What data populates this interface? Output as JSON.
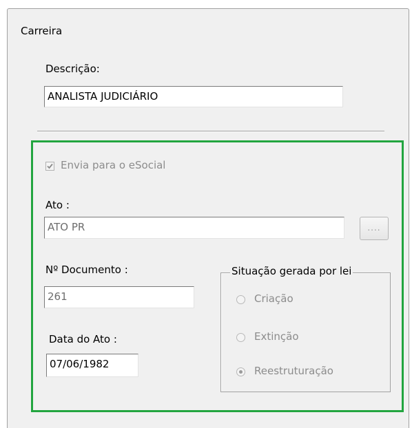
{
  "window": {
    "title": "Carreira"
  },
  "descricao": {
    "label": "Descrição:",
    "value": "ANALISTA JUDICIÁRIO"
  },
  "esocial": {
    "checkbox_label": "Envia para o eSocial",
    "checked": true
  },
  "ato": {
    "label": "Ato :",
    "value": "ATO PR",
    "browse_label": "...."
  },
  "documento": {
    "label": "Nº Documento :",
    "value": "261"
  },
  "data_ato": {
    "label": "Data do Ato :",
    "value": "07/06/1982"
  },
  "situacao": {
    "legend": "Situação gerada por lei",
    "options": [
      {
        "label": "Criação",
        "selected": false
      },
      {
        "label": "Extinção",
        "selected": false
      },
      {
        "label": "Reestruturação",
        "selected": true
      }
    ]
  },
  "colors": {
    "highlight_border": "#22a53f",
    "disabled_text": "#8c8c8c",
    "panel_bg": "#f0f0f0"
  }
}
